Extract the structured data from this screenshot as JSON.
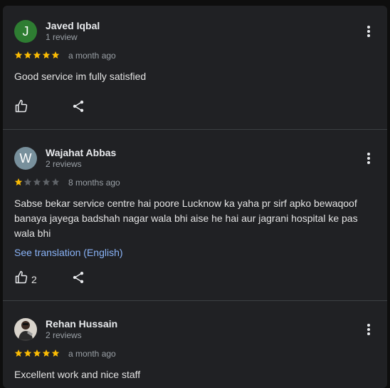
{
  "reviews": [
    {
      "avatar_letter": "J",
      "avatar_color": "#2e7d32",
      "name": "Javed Iqbal",
      "meta": "1 review",
      "rating": 5,
      "date": "a month ago",
      "text": "Good service im fully satisfied",
      "likes": ""
    },
    {
      "avatar_letter": "W",
      "avatar_color": "#78909c",
      "name": "Wajahat Abbas",
      "meta": "2 reviews",
      "rating": 1,
      "date": "8 months ago",
      "text": "Sabse bekar service centre hai poore Lucknow ka yaha pr sirf apko bewaqoof banaya jayega badshah nagar wala bhi aise he hai aur jagrani hospital ke pas wala bhi",
      "translate_label": "See translation (English)",
      "likes": "2"
    },
    {
      "avatar_icon": "user-photo-icon",
      "name": "Rehan Hussain",
      "meta": "2 reviews",
      "rating": 5,
      "date": "a month ago",
      "text": "Excellent work and nice staff"
    }
  ],
  "colors": {
    "star_filled": "#fbbc04",
    "star_empty": "#5f6368",
    "link": "#8ab4f8"
  }
}
